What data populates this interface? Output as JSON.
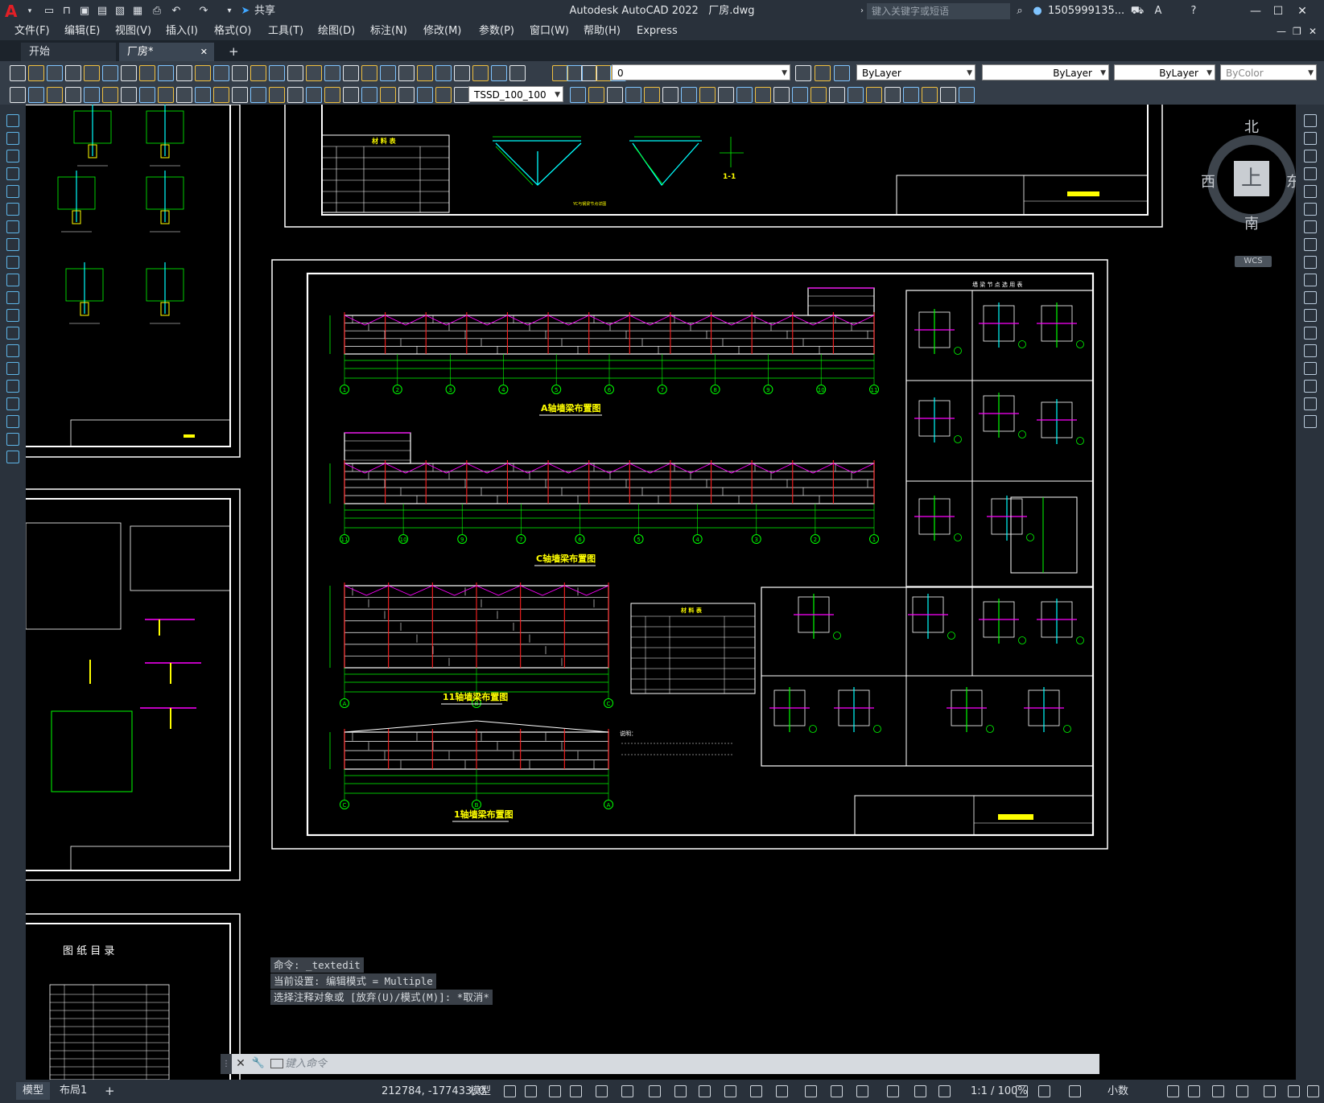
{
  "window": {
    "app_title": "Autodesk AutoCAD 2022",
    "file_name": "厂房.dwg",
    "share_label": "共享",
    "search_placeholder": "键入关键字或短语",
    "user_name": "1505999135...",
    "logo_letter": "A"
  },
  "menu": {
    "items": [
      "文件(F)",
      "编辑(E)",
      "视图(V)",
      "插入(I)",
      "格式(O)",
      "工具(T)",
      "绘图(D)",
      "标注(N)",
      "修改(M)",
      "参数(P)",
      "窗口(W)",
      "帮助(H)",
      "Express"
    ]
  },
  "tabs": {
    "start": "开始",
    "file": "厂房*",
    "close_glyph": "✕",
    "add_glyph": "+"
  },
  "toolbar": {
    "layer_value": "0",
    "color_value": "ByLayer",
    "linetype_value": "ByLayer",
    "lineweight_value": "ByLayer",
    "plotstyle_value": "ByColor",
    "dimstyle_value": "TSSD_100_100"
  },
  "viewcube": {
    "north": "北",
    "south": "南",
    "east": "东",
    "west": "西",
    "face": "上",
    "wcs": "WCS"
  },
  "drawing": {
    "sheet_top_title": "YC与钢梁节点详图",
    "sheet_top_label": "1-1",
    "table_top_title": "材 料 表",
    "table_mid_title": "材 料 表",
    "view_a_title": "A轴墙梁布置图",
    "view_c_title": "C轴墙梁布置图",
    "view_11_title": "11轴墙梁布置图",
    "view_1_title": "1轴墙梁布置图",
    "axis_numbers_a": [
      "1",
      "2",
      "3",
      "4",
      "5",
      "6",
      "7",
      "8",
      "9",
      "10",
      "11"
    ],
    "axis_numbers_c": [
      "11",
      "10",
      "9",
      "7",
      "6",
      "5",
      "4",
      "3",
      "2",
      "1"
    ],
    "axis_letters": [
      "A",
      "B",
      "C"
    ],
    "detail_header": "墙 梁 节 点 选 用 表",
    "left_sheet_title": "图 纸 目 录",
    "notes_title": "说明："
  },
  "command": {
    "history": [
      "命令: _textedit",
      "当前设置: 编辑模式 = Multiple",
      "选择注释对象或 [放弃(U)/模式(M)]: *取消*"
    ],
    "placeholder": "键入命令"
  },
  "status": {
    "model_tab": "模型",
    "layout_tab": "布局1",
    "coords": "212784, -177433, 0",
    "model_label": "模型",
    "scale": "1:1 / 100%",
    "units": "小数"
  }
}
